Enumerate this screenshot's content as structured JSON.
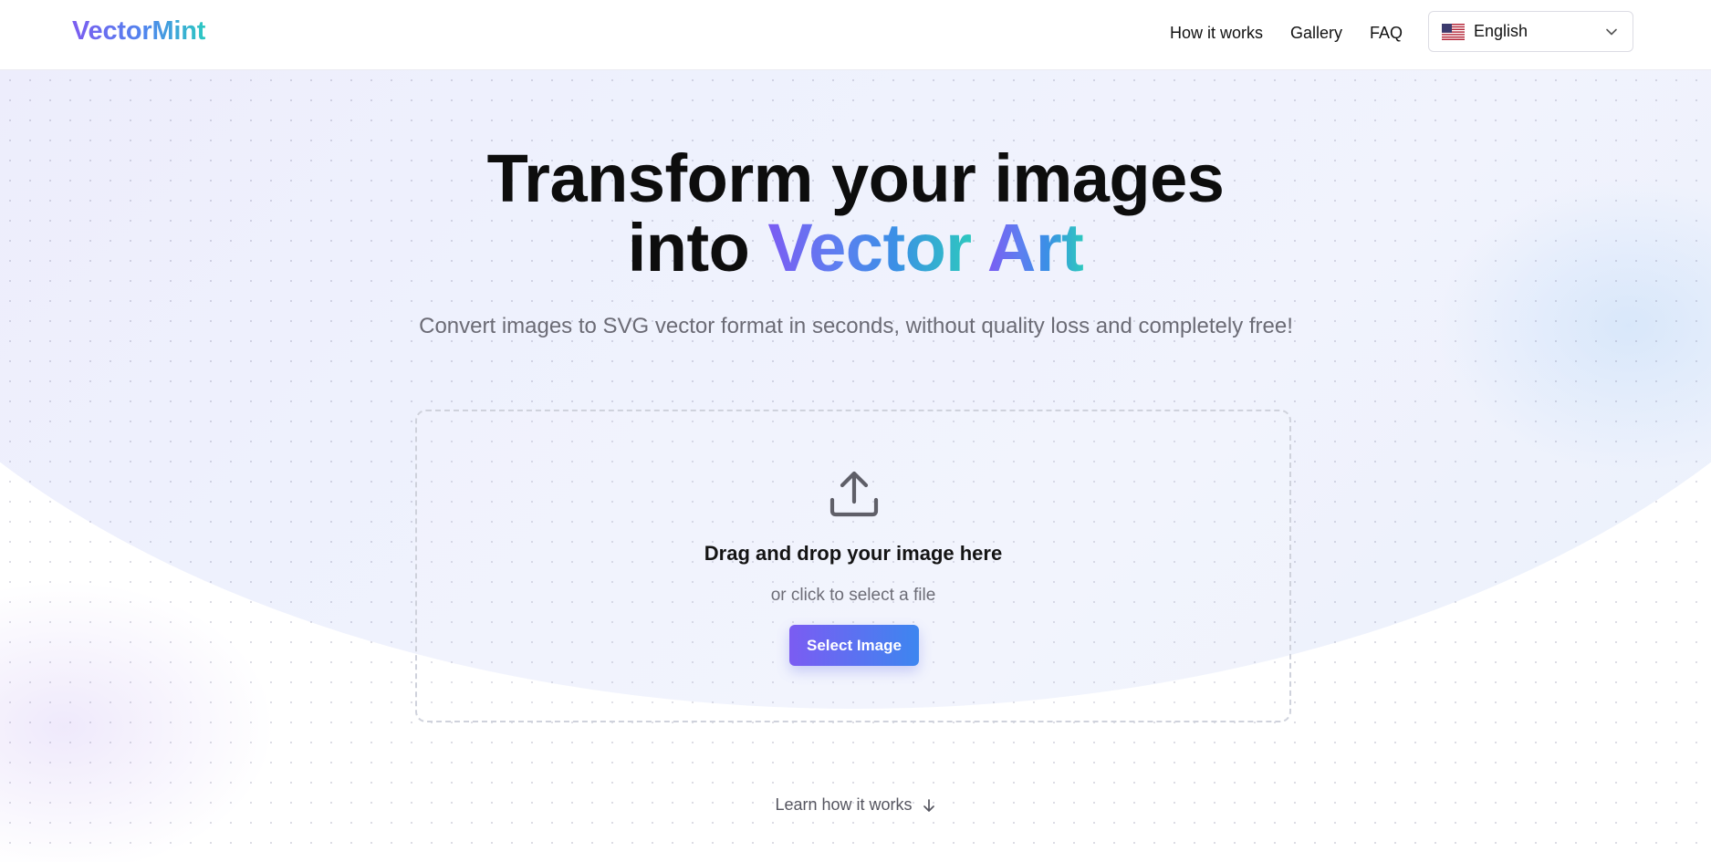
{
  "header": {
    "logo_text": "VectorMint",
    "nav": [
      {
        "label": "How it works"
      },
      {
        "label": "Gallery"
      },
      {
        "label": "FAQ"
      }
    ],
    "language_selector": {
      "selected": "English",
      "flag_icon": "us-flag-icon",
      "chevron_icon": "chevron-down-icon"
    }
  },
  "hero": {
    "title_line1": "Transform your images",
    "title_line2_prefix": "into",
    "title_gradient_part1": "Vector",
    "title_gradient_part2": "Art",
    "subtitle": "Convert images to SVG vector format in seconds, without quality loss and completely free!"
  },
  "dropzone": {
    "icon": "upload-icon",
    "title": "Drag and drop your image here",
    "subtitle": "or click to select a file",
    "button_label": "Select Image"
  },
  "footer_link": {
    "label": "Learn how it works",
    "icon": "arrow-down-icon"
  },
  "colors": {
    "brand_purple": "#7b5cf2",
    "brand_blue": "#3d86f0",
    "brand_teal": "#2ec8bf",
    "text_dark": "#111111",
    "text_muted": "#6b6b75"
  }
}
